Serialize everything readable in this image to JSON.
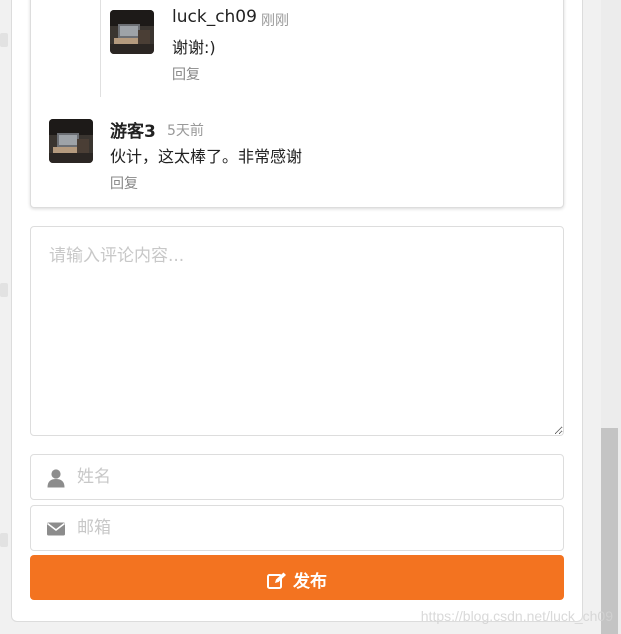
{
  "comments": [
    {
      "author": "luck_ch09",
      "time": "刚刚",
      "content": "谢谢:)",
      "reply_label": "回复",
      "is_reply": true
    },
    {
      "author": "游客3",
      "time": "5天前",
      "content": "伙计，这太棒了。非常感谢",
      "reply_label": "回复",
      "is_reply": false
    }
  ],
  "form": {
    "comment_placeholder": "请输入评论内容...",
    "name_placeholder": "姓名",
    "email_placeholder": "邮箱",
    "submit_label": "发布",
    "name_icon": "user-icon",
    "email_icon": "envelope-icon",
    "submit_icon": "edit-icon"
  },
  "watermark": "https://blog.csdn.net/luck_ch09",
  "colors": {
    "accent": "#f37320",
    "background": "#f1f1f1",
    "muted_text": "#999999"
  }
}
